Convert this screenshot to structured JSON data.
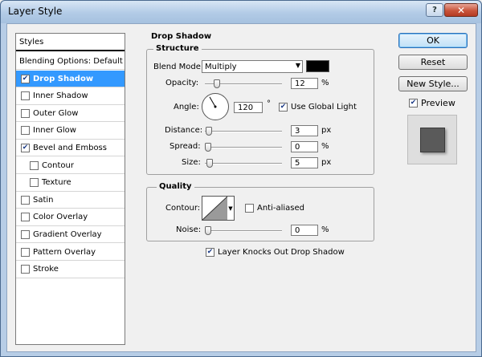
{
  "window": {
    "title": "Layer Style",
    "help_glyph": "?",
    "close_glyph": "✕"
  },
  "sidebar": {
    "header": "Styles",
    "blending_options": "Blending Options: Default",
    "items": [
      {
        "label": "Drop Shadow",
        "checked": true,
        "selected": true,
        "indent": false
      },
      {
        "label": "Inner Shadow",
        "checked": false,
        "selected": false,
        "indent": false
      },
      {
        "label": "Outer Glow",
        "checked": false,
        "selected": false,
        "indent": false
      },
      {
        "label": "Inner Glow",
        "checked": false,
        "selected": false,
        "indent": false
      },
      {
        "label": "Bevel and Emboss",
        "checked": true,
        "selected": false,
        "indent": false
      },
      {
        "label": "Contour",
        "checked": false,
        "selected": false,
        "indent": true
      },
      {
        "label": "Texture",
        "checked": false,
        "selected": false,
        "indent": true
      },
      {
        "label": "Satin",
        "checked": false,
        "selected": false,
        "indent": false
      },
      {
        "label": "Color Overlay",
        "checked": false,
        "selected": false,
        "indent": false
      },
      {
        "label": "Gradient Overlay",
        "checked": false,
        "selected": false,
        "indent": false
      },
      {
        "label": "Pattern Overlay",
        "checked": false,
        "selected": false,
        "indent": false
      },
      {
        "label": "Stroke",
        "checked": false,
        "selected": false,
        "indent": false
      }
    ]
  },
  "drop_shadow": {
    "section_title": "Drop Shadow",
    "structure": {
      "title": "Structure",
      "blend_mode_label": "Blend Mode:",
      "blend_mode_value": "Multiply",
      "shadow_color": "#000000",
      "opacity_label": "Opacity:",
      "opacity_value": "12",
      "opacity_unit": "%",
      "opacity_fraction": 0.12,
      "angle_label": "Angle:",
      "angle_value": "120",
      "angle_degrees": 120,
      "angle_unit": "°",
      "use_global_light_label": "Use Global Light",
      "use_global_light_checked": true,
      "distance_label": "Distance:",
      "distance_value": "3",
      "distance_unit": "px",
      "distance_fraction": 0.01,
      "spread_label": "Spread:",
      "spread_value": "0",
      "spread_unit": "%",
      "spread_fraction": 0.0,
      "size_label": "Size:",
      "size_value": "5",
      "size_unit": "px",
      "size_fraction": 0.02
    },
    "quality": {
      "title": "Quality",
      "contour_label": "Contour:",
      "anti_aliased_label": "Anti-aliased",
      "anti_aliased_checked": false,
      "noise_label": "Noise:",
      "noise_value": "0",
      "noise_unit": "%",
      "noise_fraction": 0.0
    },
    "knocks_out_label": "Layer Knocks Out Drop Shadow",
    "knocks_out_checked": true
  },
  "buttons": {
    "ok": "OK",
    "reset": "Reset",
    "new_style": "New Style...",
    "preview_label": "Preview",
    "preview_checked": true
  },
  "colors": {
    "selection": "#3399ff",
    "preview_fill": "#5a5a5a"
  }
}
